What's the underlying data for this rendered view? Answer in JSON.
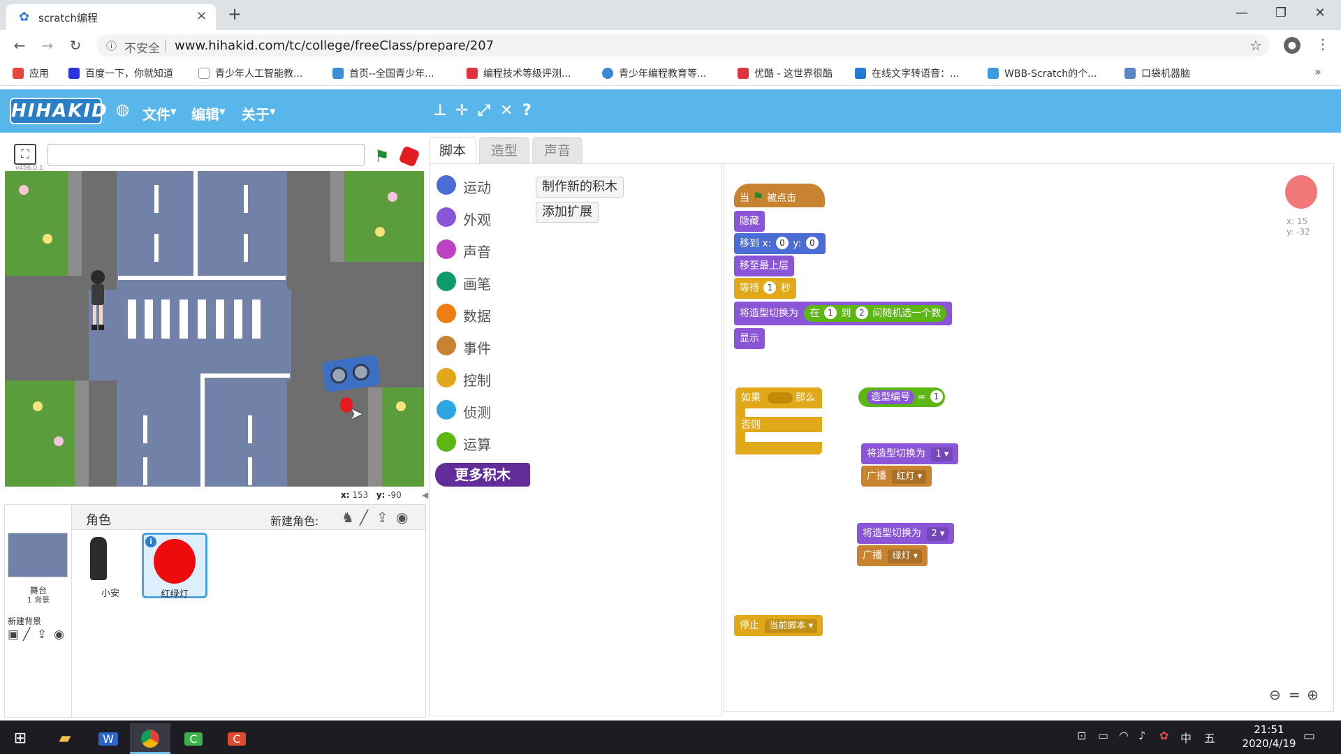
{
  "browser": {
    "tab_title": "scratch编程",
    "tab_close": "×",
    "new_tab": "+",
    "window_min": "—",
    "window_restore": "❐",
    "window_close": "✕",
    "nav_back": "←",
    "nav_forward": "→",
    "nav_reload": "↻",
    "security_label": "不安全",
    "url": "www.hihakid.com/tc/college/freeClass/prepare/207",
    "bookmark_star": "☆",
    "menu_dots": "⋮",
    "bookmarks": [
      {
        "label": "应用",
        "icon": "apps-grid-icon",
        "color": "#e8453c"
      },
      {
        "label": "百度一下，你就知道",
        "icon": "baidu-icon",
        "color": "#2932e1"
      },
      {
        "label": "青少年人工智能教...",
        "icon": "page-icon",
        "color": "#cccccc"
      },
      {
        "label": "首页--全国青少年...",
        "icon": "site-icon",
        "color": "#3d8fd6"
      },
      {
        "label": "编程技术等级评测...",
        "icon": "robot-icon",
        "color": "#e0333c"
      },
      {
        "label": "青少年编程教育等...",
        "icon": "globe-icon",
        "color": "#3a86d9"
      },
      {
        "label": "优酷 - 这世界很酷",
        "icon": "youku-icon",
        "color": "#e0333c"
      },
      {
        "label": "在线文字转语音：...",
        "icon": "tts-icon",
        "color": "#1f7ad8"
      },
      {
        "label": "WBB-Scratch的个...",
        "icon": "bilibili-icon",
        "color": "#3b9be0"
      },
      {
        "label": "口袋机器脑",
        "icon": "site-icon",
        "color": "#5a86c4"
      }
    ],
    "bookmarks_more": "»"
  },
  "scratch": {
    "logo": "HIHAKID",
    "menus": [
      "文件",
      "编辑",
      "关于"
    ],
    "toolbar_icons": [
      "stamp-icon",
      "grow-icon",
      "shrink-icon",
      "expand-icon",
      "help-icon"
    ],
    "version": "v456.0.1",
    "project_title": "",
    "tabs": [
      "脚本",
      "造型",
      "声音"
    ],
    "active_tab": "脚本",
    "mouse_x_label": "x:",
    "mouse_x": "153",
    "mouse_y_label": "y:",
    "mouse_y": "-90",
    "categories": [
      {
        "label": "运动",
        "color": "#4a6cd4"
      },
      {
        "label": "外观",
        "color": "#8a55d7"
      },
      {
        "label": "声音",
        "color": "#bb42c3"
      },
      {
        "label": "画笔",
        "color": "#0e9a6c"
      },
      {
        "label": "数据",
        "color": "#ee7d16"
      },
      {
        "label": "事件",
        "color": "#c88330"
      },
      {
        "label": "控制",
        "color": "#e1a91a"
      },
      {
        "label": "侦测",
        "color": "#2ca5e2"
      },
      {
        "label": "运算",
        "color": "#5cb712"
      }
    ],
    "more_blocks": "更多积木",
    "make_block": "制作新的积木",
    "add_extension": "添加扩展",
    "sprites_label": "角色",
    "new_sprite_label": "新建角色:",
    "stage_thumb_label": "舞台",
    "stage_thumb_sub": "1 背景",
    "new_backdrop_label": "新建背景",
    "sprites": [
      {
        "name": "小安",
        "selected": false
      },
      {
        "name": "红绿灯",
        "selected": true
      }
    ],
    "sprite_info": "i",
    "sprite_x": "x: 15",
    "sprite_y": "y: -32",
    "blocks": {
      "when_flag_a": "当",
      "when_flag_b": "被点击",
      "hide": "隐藏",
      "goto_label": "移到 x:",
      "goto_x": "0",
      "goto_y_label": "y:",
      "goto_y": "0",
      "front": "移至最上层",
      "wait_label": "等待",
      "wait_val": "1",
      "wait_unit": "秒",
      "switch_costume": "将造型切换为",
      "random_a": "在",
      "random_from": "1",
      "random_to_label": "到",
      "random_to": "2",
      "random_b": "间随机选一个数",
      "show": "显示",
      "if_label": "如果",
      "then_label": "那么",
      "else_label": "否则",
      "costume_num": "造型编号",
      "equals": "=",
      "equals_val": "1",
      "switch_costume_1": "将造型切换为",
      "costume_1": "1",
      "broadcast_1": "广播",
      "message_red": "红灯",
      "switch_costume_2": "将造型切换为",
      "costume_2": "2",
      "broadcast_2": "广播",
      "message_green": "绿灯",
      "stop_label": "停止",
      "stop_option": "当前脚本"
    }
  },
  "taskbar": {
    "apps": [
      "windows-start-icon",
      "file-explorer-icon",
      "wps-icon",
      "chrome-icon",
      "camtasia-icon",
      "camtasia-recorder-icon"
    ],
    "tray_ime": "中",
    "tray_ime2": "五",
    "time": "21:51",
    "date": "2020/4/19"
  }
}
